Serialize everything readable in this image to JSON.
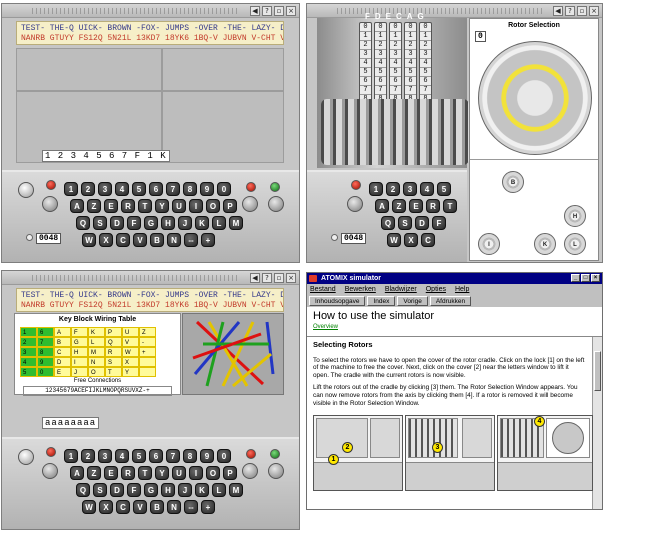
{
  "tape": {
    "plain": "TEST- THE-Q UICK- BROWN -FOX- JUMPS -OVER -THE- LAZY- DOG",
    "cipher": "NANRB GTUYY FS12Q 5N21L 13KD7 18YK6 1BQ-V JUBVN V-CHT VNS"
  },
  "lamps_display": "1 2 3 4 5 6 7 F 1 K",
  "lamps_display_2": "aaaaaaaa",
  "counter": "0048",
  "keyboard": {
    "row1": [
      "1",
      "2",
      "3",
      "4",
      "5",
      "6",
      "7",
      "8",
      "9",
      "0"
    ],
    "row2": [
      "A",
      "Z",
      "E",
      "R",
      "T",
      "Y",
      "U",
      "I",
      "O",
      "P"
    ],
    "row3": [
      "Q",
      "S",
      "D",
      "F",
      "G",
      "H",
      "J",
      "K",
      "L",
      "M"
    ],
    "row4": [
      "W",
      "X",
      "C",
      "V",
      "B",
      "N",
      "--",
      "+"
    ]
  },
  "rotor_letters": "FDECAG",
  "rotor_selection": {
    "title": "Rotor Selection",
    "counter": "0",
    "rotors": [
      "B",
      "H",
      "I",
      "K",
      "L"
    ]
  },
  "wiring": {
    "title": "Key Block Wiring Table",
    "free_title": "Free Connections",
    "free_value": "12345679ACEFIJKLMNOPQRSUVXZ-+",
    "cells": [
      [
        "1",
        "6",
        "A",
        "F",
        "K",
        "P",
        "U",
        "Z"
      ],
      [
        "2",
        "7",
        "B",
        "G",
        "L",
        "Q",
        "V",
        "-"
      ],
      [
        "3",
        "8",
        "C",
        "H",
        "M",
        "R",
        "W",
        "+"
      ],
      [
        "4",
        "9",
        "D",
        "I",
        "N",
        "S",
        "X",
        ""
      ],
      [
        "5",
        "0",
        "E",
        "J",
        "O",
        "T",
        "Y",
        ""
      ]
    ]
  },
  "atomix": {
    "title": "ATOMIX simulator",
    "menu": [
      "Bestand",
      "Bewerken",
      "Bladwijzer",
      "Opties",
      "Help"
    ],
    "toolbar": [
      "Inhoudsopgave",
      "Index",
      "Vorige",
      "Afdrukken"
    ],
    "heading": "How to use the simulator",
    "overview": "Overview",
    "section": "Selecting Rotors",
    "p1": "To select the rotors we have to open the cover of the rotor cradle. Click on the lock [1] on the left of the machine to free the cover. Next, click on the cover [2] near the letters window to lift it open. The cradle with the current rotors is now visible.",
    "p2": "Lift the rotors out of the cradle by clicking [3] them. The Rotor Selection Window appears. You can now remove rotors from the axis by clicking them [4]. If a rotor is removed it will become visible in the Rotor Selection Window.",
    "badges": [
      "1",
      "2",
      "3",
      "4"
    ]
  },
  "icons": [
    "speaker-icon",
    "help-icon",
    "restore-icon",
    "close-icon"
  ]
}
